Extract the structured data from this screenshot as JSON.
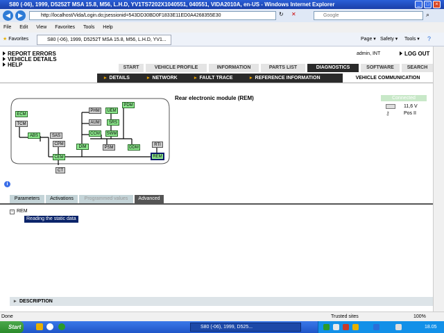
{
  "browser": {
    "window_title": "S80 (-06), 1999, D5252T MSA 15.8, M56, L.H.D, YV1TS7202X1040551, 040551, VIDA2010A, en-US - Windows Internet Explorer",
    "address": "http://localhost/Vida/Login.do;jsessionid=543DD30BD0F1833E11ED0A4268355E30",
    "search_placeholder": "Google",
    "menu": [
      "File",
      "Edit",
      "View",
      "Favorites",
      "Tools",
      "Help"
    ],
    "favorites_label": "Favorites",
    "tab_title": "S80 (-06), 1999, D5252T MSA 15.8, M56, L.H.D, YV1...",
    "cmd_page": "Page",
    "cmd_safety": "Safety",
    "cmd_tools": "Tools",
    "status_left": "Done",
    "status_zone": "Trusted sites",
    "status_zoom": "100%"
  },
  "app": {
    "top_links": [
      "REPORT ERRORS",
      "VEHICLE DETAILS",
      "HELP"
    ],
    "user": "admin, INT",
    "logout": "LOG OUT",
    "nav_tabs": [
      "START",
      "VEHICLE PROFILE",
      "INFORMATION",
      "PARTS LIST",
      "DIAGNOSTICS",
      "SOFTWARE",
      "SEARCH"
    ],
    "active_tab": "DIAGNOSTICS",
    "sub_tabs": [
      "DETAILS",
      "NETWORK",
      "FAULT TRACE",
      "REFERENCE INFORMATION"
    ],
    "sub_active": "VEHICLE COMMUNICATION",
    "module_title": "Rear electronic module (REM)",
    "connection": {
      "status": "Connected",
      "voltage": "11,6 V",
      "ignition": "Pos II"
    },
    "ecus": [
      "ECM",
      "TCM",
      "ABS",
      "SAS",
      "CPM",
      "CEM",
      "CT",
      "PHM",
      "AUM",
      "CCM",
      "SWM",
      "UEM",
      "SRS",
      "PDM",
      "DIM",
      "PSM",
      "DDM",
      "RTI",
      "REM"
    ],
    "panel_tabs": [
      "Parameters",
      "Activations",
      "Programmed values",
      "Advanced"
    ],
    "panel_active": "Advanced",
    "tree_root": "REM",
    "tree_item": "Reading the static data",
    "description_label": "DESCRIPTION"
  },
  "taskbar": {
    "start": "Start",
    "item": "S80 (-06), 1999, D525...",
    "clock": "18.05"
  }
}
